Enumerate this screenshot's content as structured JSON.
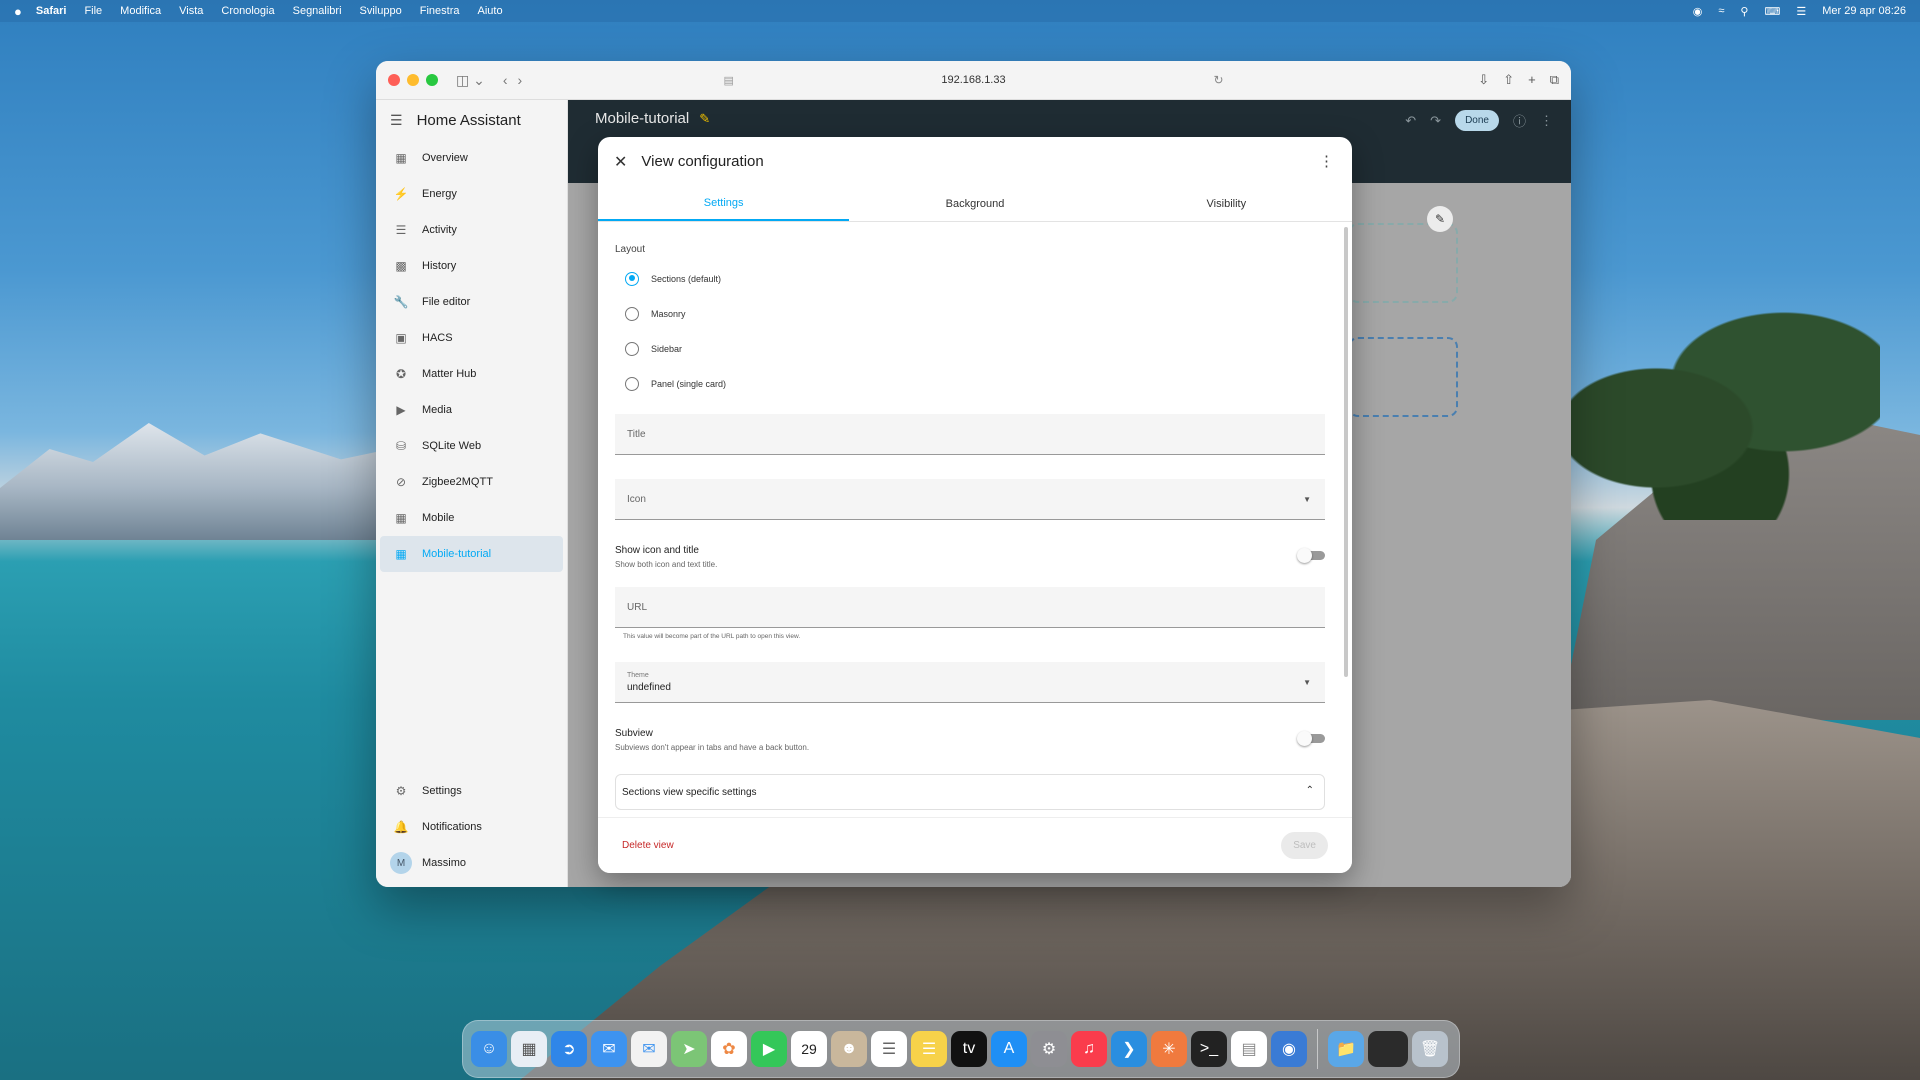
{
  "menubar": {
    "apple": "",
    "items": [
      "Safari",
      "File",
      "Modifica",
      "Vista",
      "Cronologia",
      "Segnalibri",
      "Sviluppo",
      "Finestra",
      "Aiuto"
    ],
    "datetime": "Mer 29 apr  08:26"
  },
  "browser": {
    "url": "192.168.1.33"
  },
  "sidebar": {
    "title": "Home Assistant",
    "items": [
      {
        "label": "Overview",
        "icon": "overview-icon"
      },
      {
        "label": "Energy",
        "icon": "energy-icon"
      },
      {
        "label": "Activity",
        "icon": "activity-icon"
      },
      {
        "label": "History",
        "icon": "history-icon"
      },
      {
        "label": "File editor",
        "icon": "wrench-icon"
      },
      {
        "label": "HACS",
        "icon": "hacs-icon"
      },
      {
        "label": "Matter Hub",
        "icon": "matter-icon"
      },
      {
        "label": "Media",
        "icon": "media-icon"
      },
      {
        "label": "SQLite Web",
        "icon": "database-icon"
      },
      {
        "label": "Zigbee2MQTT",
        "icon": "zigbee-icon"
      },
      {
        "label": "Mobile",
        "icon": "dashboard-icon"
      },
      {
        "label": "Mobile-tutorial",
        "icon": "dashboard-icon"
      }
    ],
    "bottom": {
      "settings": "Settings",
      "notifications": "Notifications",
      "user": "Massimo",
      "user_initial": "M"
    }
  },
  "topbar": {
    "dashboard_title": "Mobile-tutorial",
    "done": "Done"
  },
  "dialog": {
    "title": "View configuration",
    "tabs": [
      "Settings",
      "Background",
      "Visibility"
    ],
    "layout_label": "Layout",
    "layout_options": [
      "Sections (default)",
      "Masonry",
      "Sidebar",
      "Panel (single card)"
    ],
    "selected_layout": "Sections (default)",
    "title_placeholder": "Title",
    "icon_placeholder": "Icon",
    "show_icon_title": {
      "label": "Show icon and title",
      "desc": "Show both icon and text title.",
      "on": false
    },
    "url_placeholder": "URL",
    "url_helper": "This value will become part of the URL path to open this view.",
    "theme_label": "Theme",
    "theme_value": "undefined",
    "subview": {
      "label": "Subview",
      "desc": "Subviews don't appear in tabs and have a back button.",
      "on": false
    },
    "sections_settings": "Sections view specific settings",
    "delete": "Delete view",
    "save": "Save"
  },
  "colors": {
    "accent": "#03a9f4",
    "danger": "#c62828",
    "topbar": "#1f2c33"
  }
}
